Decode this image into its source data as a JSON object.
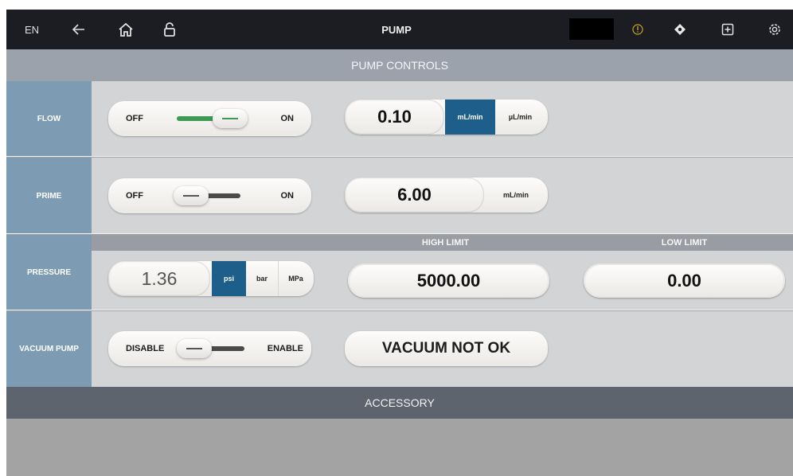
{
  "topbar": {
    "language": "EN",
    "title": "PUMP",
    "icons": [
      "back-arrow-icon",
      "home-icon",
      "lock-icon",
      "warning-icon",
      "droplet-icon",
      "plus-box-icon",
      "gear-icon"
    ],
    "warning_color": "#c9a227"
  },
  "pump_controls": {
    "header": "PUMP CONTROLS",
    "flow": {
      "label": "FLOW",
      "toggle_off": "OFF",
      "toggle_on": "ON",
      "state": "on",
      "value": "0.10",
      "units": [
        "mL/min",
        "µL/min"
      ],
      "selected_unit": "mL/min"
    },
    "prime": {
      "label": "PRIME",
      "toggle_off": "OFF",
      "toggle_on": "ON",
      "state": "off",
      "value": "6.00",
      "unit": "mL/min"
    },
    "pressure": {
      "label": "PRESSURE",
      "value": "1.36",
      "units": [
        "psi",
        "bar",
        "MPa"
      ],
      "selected_unit": "psi",
      "high_limit_label": "HIGH LIMIT",
      "high_limit": "5000.00",
      "low_limit_label": "LOW LIMIT",
      "low_limit": "0.00"
    },
    "vacuum_pump": {
      "label": "VACUUM PUMP",
      "toggle_off": "DISABLE",
      "toggle_on": "ENABLE",
      "state": "disable",
      "status": "VACUUM NOT OK"
    }
  },
  "accessory": {
    "header": "ACCESSORY"
  },
  "colors": {
    "accent_blue": "#1d5e8a",
    "toggle_green": "#3c9a52",
    "row_label_bg": "#7d9bb2"
  }
}
